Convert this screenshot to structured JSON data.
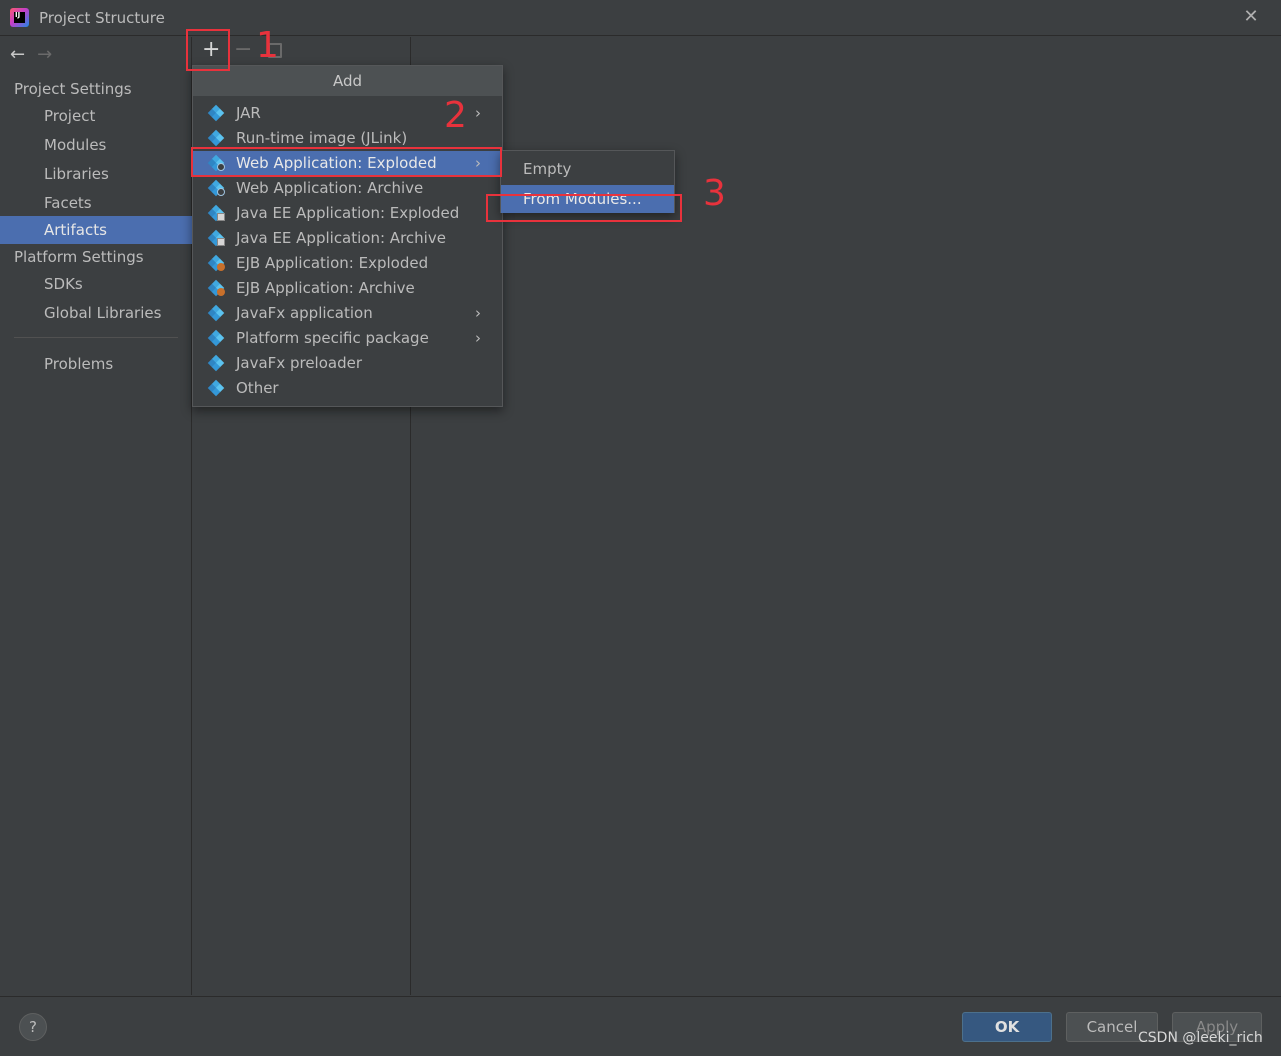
{
  "window": {
    "title": "Project Structure",
    "close_glyph": "✕",
    "app_icon_text": "IJ"
  },
  "nav": {
    "back_glyph": "←",
    "forward_glyph": "→"
  },
  "sidebar": {
    "project_settings_label": "Project Settings",
    "project_settings_items": [
      "Project",
      "Modules",
      "Libraries",
      "Facets",
      "Artifacts"
    ],
    "selected_item": "Artifacts",
    "platform_settings_label": "Platform Settings",
    "platform_settings_items": [
      "SDKs",
      "Global Libraries"
    ],
    "problems_label": "Problems"
  },
  "toolbar": {
    "add_glyph": "+",
    "remove_glyph": "−"
  },
  "add_menu": {
    "header": "Add",
    "items": [
      {
        "label": "JAR",
        "icon": "jar-icon",
        "has_submenu": true
      },
      {
        "label": "Run-time image (JLink)",
        "icon": "jlink-icon",
        "has_submenu": false
      },
      {
        "label": "Web Application: Exploded",
        "icon": "web-app-icon",
        "has_submenu": true,
        "active": true
      },
      {
        "label": "Web Application: Archive",
        "icon": "web-app-icon",
        "has_submenu": false
      },
      {
        "label": "Java EE Application: Exploded",
        "icon": "javaee-icon",
        "has_submenu": false
      },
      {
        "label": "Java EE Application: Archive",
        "icon": "javaee-icon",
        "has_submenu": false
      },
      {
        "label": "EJB Application: Exploded",
        "icon": "ejb-icon",
        "has_submenu": false
      },
      {
        "label": "EJB Application: Archive",
        "icon": "ejb-icon",
        "has_submenu": false
      },
      {
        "label": "JavaFx application",
        "icon": "javafx-icon",
        "has_submenu": true
      },
      {
        "label": "Platform specific package",
        "icon": "package-icon",
        "has_submenu": true
      },
      {
        "label": "JavaFx preloader",
        "icon": "javafx-icon",
        "has_submenu": false
      },
      {
        "label": "Other",
        "icon": "other-icon",
        "has_submenu": false
      }
    ],
    "submenu_arrow": "›"
  },
  "submenu": {
    "items": [
      "Empty",
      "From Modules..."
    ],
    "active_item": "From Modules..."
  },
  "annotations": [
    "1",
    "2",
    "3"
  ],
  "footer": {
    "help_glyph": "?",
    "ok_label": "OK",
    "cancel_label": "Cancel",
    "apply_label": "Apply"
  },
  "watermark": "CSDN @leeki_rich",
  "colors": {
    "accent": "#4b6eaf",
    "annotation": "#e8323c",
    "background": "#3c3f41"
  }
}
